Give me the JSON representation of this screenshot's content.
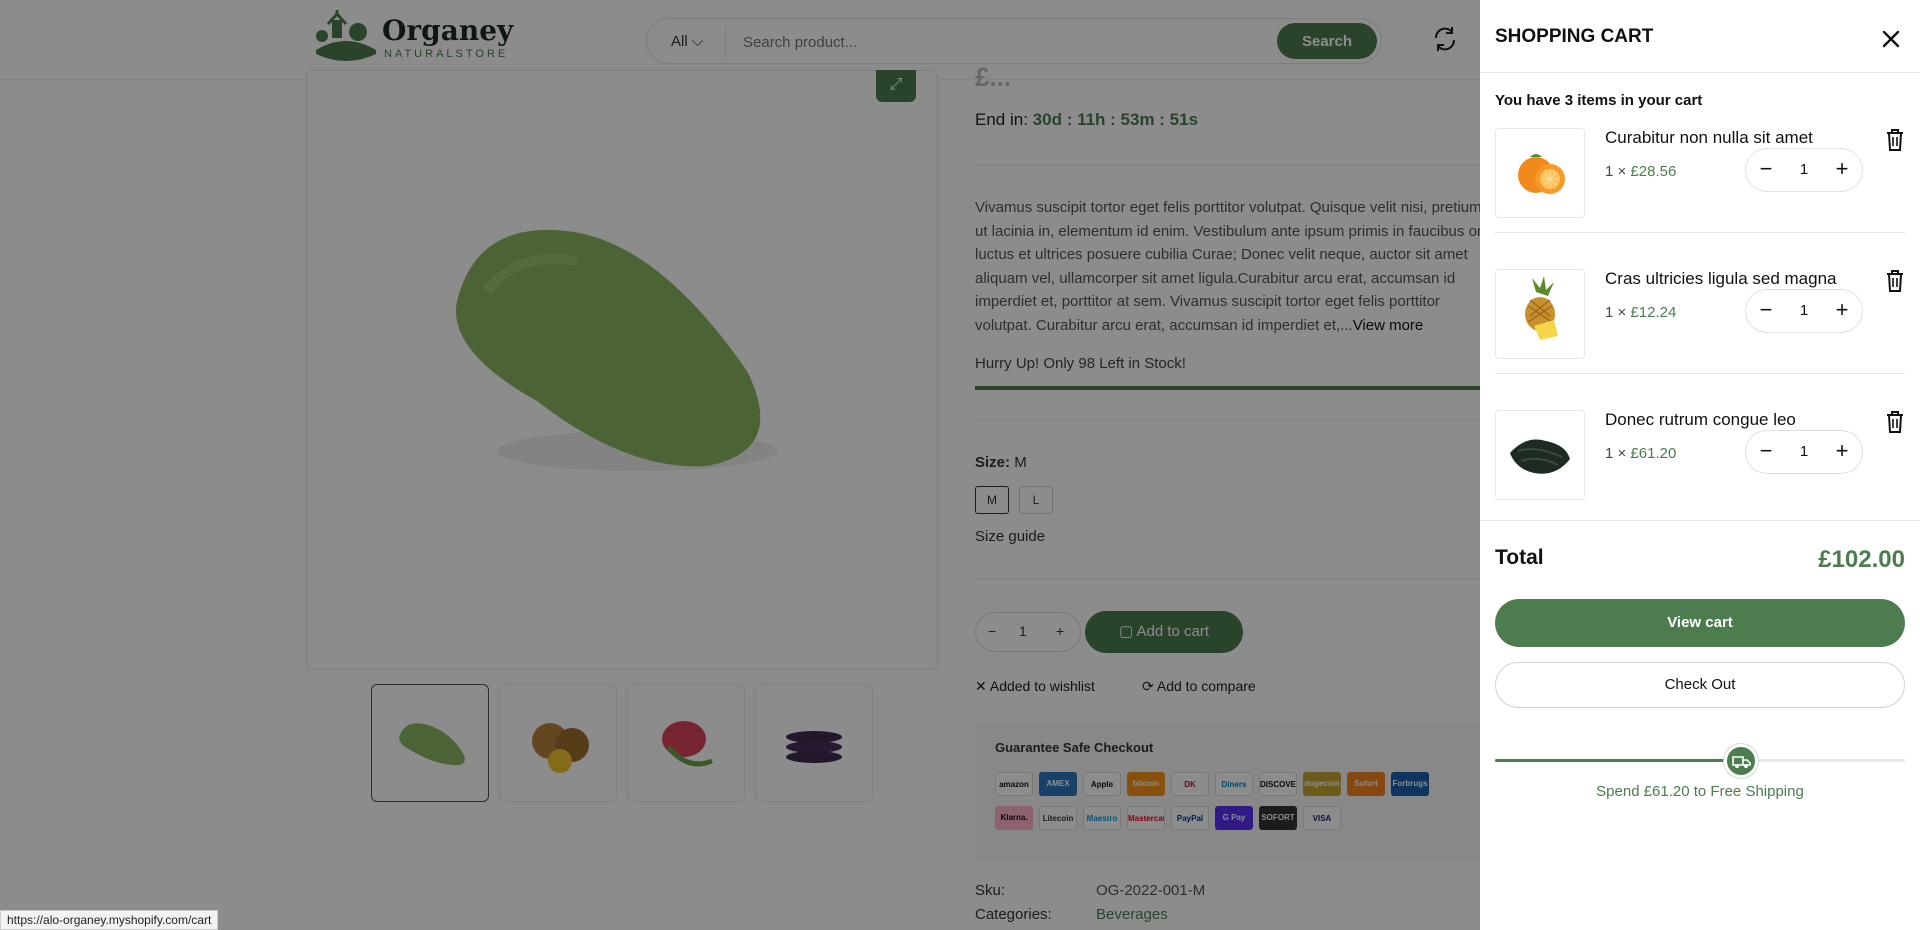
{
  "header": {
    "logo_name": "Organey",
    "logo_sub": "NATURALSTORE",
    "search_category": "All",
    "search_placeholder": "Search product...",
    "search_button": "Search"
  },
  "product": {
    "end_in_label": "End in:",
    "countdown": "30d : 11h : 53m : 51s",
    "description": "Vivamus suscipit tortor eget felis porttitor volutpat. Quisque velit nisi, pretium ut lacinia in, elementum id enim. Vestibulum ante ipsum primis in faucibus orci luctus et ultrices posuere cubilia Curae; Donec velit neque, auctor sit amet aliquam vel, ullamcorper sit amet ligula.Curabitur arcu erat, accumsan id imperdiet et, porttitor at sem. Vivamus suscipit tortor eget felis porttitor volutpat. Curabitur arcu erat, accumsan id imperdiet et,...",
    "view_more": "View more",
    "hurry_text": "Hurry Up! Only 98 Left in Stock!",
    "size_label": "Size:",
    "size_value": "M",
    "size_options": [
      "M",
      "L"
    ],
    "size_guide": "Size guide",
    "qty": "1",
    "qty_minus": "−",
    "qty_plus": "+",
    "add_to_cart": "Add to cart",
    "wishlist": "Added to wishlist",
    "compare": "Add to compare",
    "guarantee_title": "Guarantee Safe Checkout",
    "payment_methods": [
      "amazon",
      "AMEX",
      "Apple Pay",
      "bitcoin",
      "DK",
      "Diners",
      "DISCOVER",
      "dogecoin",
      "Sofort",
      "Forbrugs",
      "Klarna.",
      "Litecoin",
      "Maestro",
      "Mastercard",
      "PayPal",
      "G Pay",
      "SOFORT",
      "VISA"
    ],
    "sku_label": "Sku:",
    "sku_value": "OG-2022-001-M",
    "categories_label": "Categories:",
    "categories_value": "Beverages"
  },
  "status_bar": {
    "url": "https://alo-organey.myshopify.com/cart"
  },
  "cart": {
    "title": "SHOPPING CART",
    "count_line": "You have 3 items in your cart",
    "items": [
      {
        "name": "Curabitur non nulla sit amet",
        "qty_prefix": "1 ×",
        "price": "£28.56",
        "qty": "1",
        "image": "orange"
      },
      {
        "name": "Cras ultricies ligula sed magna",
        "qty_prefix": "1 ×",
        "price": "£12.24",
        "qty": "1",
        "image": "pineapple"
      },
      {
        "name": "Donec rutrum congue leo",
        "qty_prefix": "1 ×",
        "price": "£61.20",
        "qty": "1",
        "image": "dark-leaves"
      }
    ],
    "minus": "−",
    "plus": "+",
    "total_label": "Total",
    "total_value": "£102.00",
    "view_cart": "View cart",
    "checkout": "Check Out",
    "shipping_progress": 0.6,
    "shipping_text": "Spend £61.20 to Free Shipping"
  },
  "colors": {
    "accent": "#4d7c4f"
  }
}
